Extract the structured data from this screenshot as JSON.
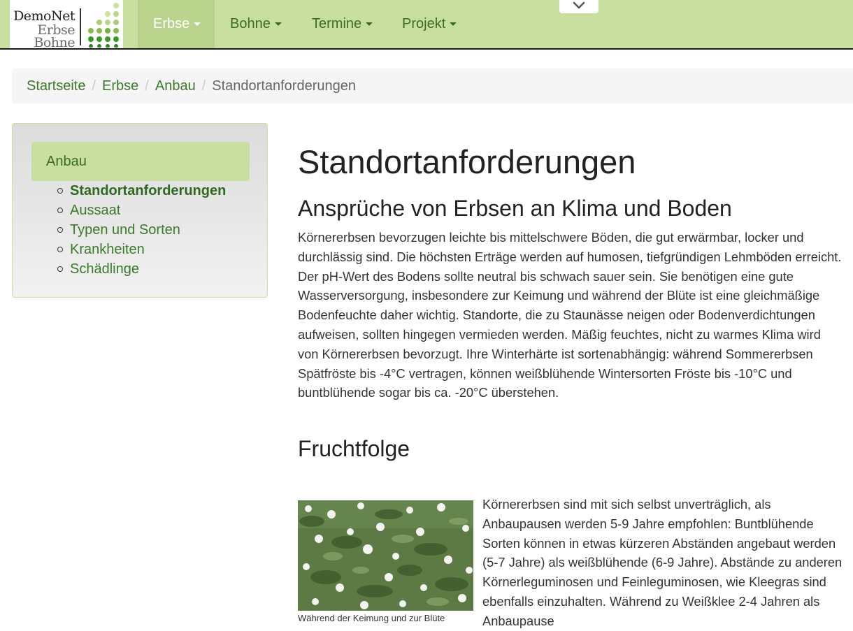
{
  "logo": {
    "line1": "DemoNet",
    "line2": "Erbse",
    "line3": "Bohne"
  },
  "nav": {
    "items": [
      {
        "label": "Erbse",
        "active": true
      },
      {
        "label": "Bohne",
        "active": false
      },
      {
        "label": "Termine",
        "active": false
      },
      {
        "label": "Projekt",
        "active": false
      }
    ],
    "collapse_icon": "chevron-down-icon"
  },
  "breadcrumb": {
    "items": [
      "Startseite",
      "Erbse",
      "Anbau",
      "Standortanforderungen"
    ],
    "separator": "/"
  },
  "sidebar": {
    "heading": "Anbau",
    "items": [
      {
        "label": "Standortanforderungen",
        "current": true
      },
      {
        "label": "Aussaat",
        "current": false
      },
      {
        "label": "Typen und Sorten",
        "current": false
      },
      {
        "label": "Krankheiten",
        "current": false
      },
      {
        "label": "Schädlinge",
        "current": false
      }
    ]
  },
  "content": {
    "title": "Standortanforderungen",
    "section1": {
      "heading": "Ansprüche von Erbsen an Klima und Boden",
      "text": "Körnererbsen bevorzugen leichte bis mittelschwere Böden, die gut erwärmbar, locker und durchlässig sind. Die höchsten Erträge werden auf humosen, tiefgründigen Lehmböden erreicht. Der pH-Wert des Bodens sollte neutral bis schwach sauer sein. Sie benötigen eine gute Wasserversorgung, insbesondere zur Keimung und während der Blüte ist eine gleichmäßige Bodenfeuchte daher wichtig. Standorte, die zu Staunässe neigen oder Bodenverdichtungen aufweisen, sollten hingegen vermieden werden. Mäßig feuchtes, nicht zu warmes Klima wird von Körnererbsen bevorzugt. Ihre Winterhärte ist sortenabhängig: während Sommererbsen Spätfröste bis -4°C vertragen, können weißblühende Wintersorten Fröste bis -10°C und buntblühende sogar bis ca. -20°C überstehen."
    },
    "section2": {
      "heading": "Fruchtfolge",
      "text": "Körnererbsen sind mit sich selbst unverträglich, als Anbaupausen werden 5-9 Jahre empfohlen: Buntblühende Sorten können in etwas kürzeren Abständen angebaut werden (5-7 Jahre) als weißblühende (6-9 Jahre). Abstände zu anderen Körnerleguminosen und Feinleguminosen, wie Kleegras sind ebenfalls einzuhalten. Während zu Weißklee 2-4 Jahren als Anbaupause",
      "caption": "Während der Keimung und zur Blüte"
    }
  },
  "colors": {
    "navbar": "#c9df9f",
    "nav_active": "#b9d38c",
    "link": "#3b7a2a"
  }
}
